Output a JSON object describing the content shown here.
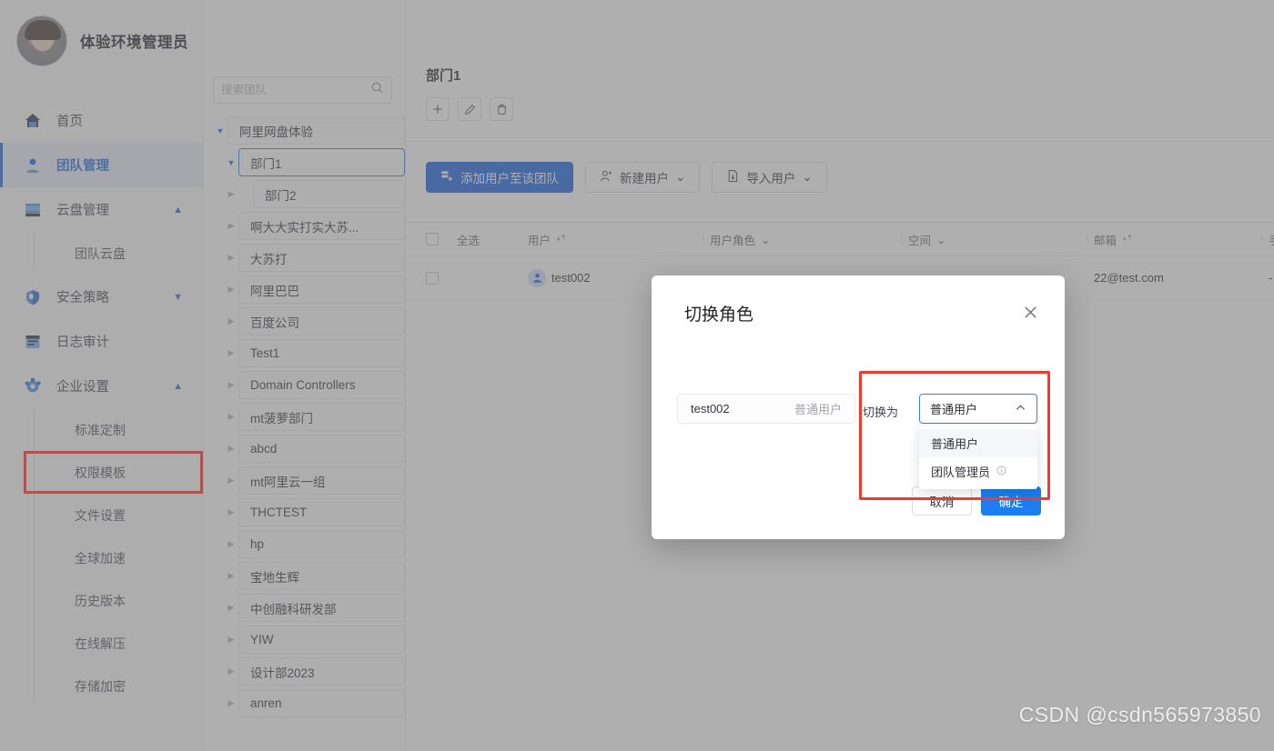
{
  "app": {
    "page_title": "团队管理",
    "watermark": "CSDN @csdn565973850"
  },
  "profile": {
    "name": "体验环境管理员",
    "avatar_icon": "user-avatar-photo"
  },
  "sidebar": {
    "items": [
      {
        "label": "首页",
        "icon": "home-icon",
        "active": false,
        "caret": ""
      },
      {
        "label": "团队管理",
        "icon": "team-icon",
        "active": true,
        "caret": ""
      },
      {
        "label": "云盘管理",
        "icon": "cloud-disk-icon",
        "active": false,
        "caret": "▲"
      },
      {
        "label": "安全策略",
        "icon": "shield-icon",
        "active": false,
        "caret": "▼"
      },
      {
        "label": "日志审计",
        "icon": "log-audit-icon",
        "active": false,
        "caret": ""
      },
      {
        "label": "企业设置",
        "icon": "gear-icon",
        "active": false,
        "caret": "▲"
      }
    ],
    "cloud_sub": [
      "团队云盘"
    ],
    "enterprise_sub": [
      "标准定制",
      "权限模板",
      "文件设置",
      "全球加速",
      "历史版本",
      "在线解压",
      "存储加密"
    ],
    "highlighted_sub": "权限模板"
  },
  "tree": {
    "search_placeholder": "搜索团队",
    "search_value": "",
    "search_icon": "search-icon",
    "nodes": [
      {
        "label": "阿里网盘体验",
        "expanded": true,
        "indent": 0,
        "selected": false
      },
      {
        "label": "部门1",
        "expanded": true,
        "indent": 1,
        "selected": true
      },
      {
        "label": "部门2",
        "expanded": false,
        "indent": 2,
        "selected": false
      },
      {
        "label": "啊大大实打实大苏...",
        "expanded": false,
        "indent": 1,
        "selected": false
      },
      {
        "label": "大苏打",
        "expanded": false,
        "indent": 1,
        "selected": false
      },
      {
        "label": "阿里巴巴",
        "expanded": false,
        "indent": 1,
        "selected": false
      },
      {
        "label": "百度公司",
        "expanded": false,
        "indent": 1,
        "selected": false
      },
      {
        "label": "Test1",
        "expanded": false,
        "indent": 1,
        "selected": false
      },
      {
        "label": "Domain Controllers",
        "expanded": false,
        "indent": 1,
        "selected": false
      },
      {
        "label": "mt菠萝部门",
        "expanded": false,
        "indent": 1,
        "selected": false
      },
      {
        "label": "abcd",
        "expanded": false,
        "indent": 1,
        "selected": false
      },
      {
        "label": "mt阿里云一组",
        "expanded": false,
        "indent": 1,
        "selected": false
      },
      {
        "label": "THCTEST",
        "expanded": false,
        "indent": 1,
        "selected": false
      },
      {
        "label": "hp",
        "expanded": false,
        "indent": 1,
        "selected": false
      },
      {
        "label": "宝地生辉",
        "expanded": false,
        "indent": 1,
        "selected": false
      },
      {
        "label": "中创融科研发部",
        "expanded": false,
        "indent": 1,
        "selected": false
      },
      {
        "label": "YIW",
        "expanded": false,
        "indent": 1,
        "selected": false
      },
      {
        "label": "设计部2023",
        "expanded": false,
        "indent": 1,
        "selected": false
      },
      {
        "label": "anren",
        "expanded": false,
        "indent": 1,
        "selected": false
      }
    ]
  },
  "main": {
    "dept_title": "部门1",
    "icon_buttons": [
      {
        "name": "add-dept-button",
        "glyph": "+"
      },
      {
        "name": "edit-dept-button",
        "glyph": "✎"
      },
      {
        "name": "delete-dept-button",
        "glyph": "🗑"
      }
    ],
    "actions": {
      "add_user_label": "添加用户至该团队",
      "add_user_icon": "add-user-group-icon",
      "new_user_label": "新建用户",
      "new_user_icon": "user-plus-icon",
      "import_user_label": "导入用户",
      "import_user_icon": "file-import-icon",
      "chevron": "⌄"
    },
    "table": {
      "headers": {
        "select_all": "全选",
        "user": "用户",
        "user_role": "用户角色",
        "space": "空间",
        "email": "邮箱",
        "phone": "手机"
      },
      "sort_icon": "sort-icon",
      "filter_icon": "chevron-down-icon",
      "rows": [
        {
          "checked": false,
          "avatar_icon": "user-avatar-icon",
          "user": "test002",
          "user_role": "",
          "space": "",
          "email": "22@test.com",
          "phone": "-"
        }
      ]
    }
  },
  "modal": {
    "title": "切换角色",
    "close_icon": "close-icon",
    "user_chip": {
      "name": "test002",
      "role": "普通用户"
    },
    "switch_label": "切换为",
    "select_value": "普通用户",
    "select_caret_icon": "chevron-up-icon",
    "options": [
      {
        "label": "普通用户",
        "selected": true,
        "info_icon": ""
      },
      {
        "label": "团队管理员",
        "selected": false,
        "info_icon": "info-icon"
      }
    ],
    "cancel_label": "取消",
    "confirm_label": "确定"
  },
  "colors": {
    "accent_blue": "#1c64e0",
    "link_blue": "#2a6fdb",
    "highlight_red": "#f4392c",
    "select_border": "#3d7ee6"
  }
}
